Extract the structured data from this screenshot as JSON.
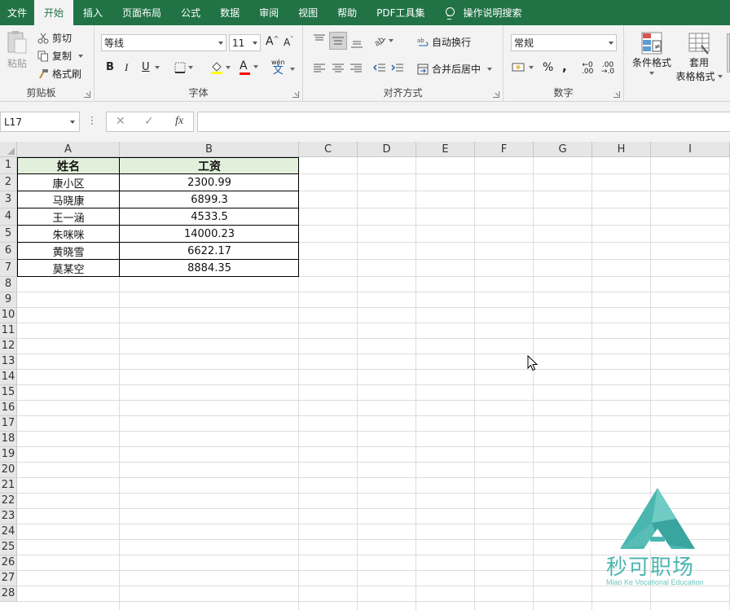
{
  "ribbon_tabs": [
    "文件",
    "开始",
    "插入",
    "页面布局",
    "公式",
    "数据",
    "审阅",
    "视图",
    "帮助",
    "PDF工具集",
    "操作说明搜索"
  ],
  "active_tab": "开始",
  "clipboard": {
    "paste": "粘贴",
    "cut": "剪切",
    "copy": "复制",
    "format_painter": "格式刷",
    "label": "剪贴板"
  },
  "font": {
    "name": "等线",
    "size": "11",
    "bold": "B",
    "italic": "I",
    "underline": "U",
    "phonetic": "wén",
    "grow": "A",
    "shrink": "A",
    "font_color": "A",
    "label": "字体"
  },
  "alignment": {
    "wrap_text": "自动换行",
    "merge_center": "合并后居中",
    "label": "对齐方式"
  },
  "number": {
    "format": "常规",
    "percent": "%",
    "comma": ",",
    "label": "数字"
  },
  "styles": {
    "conditional_formatting": "条件格式",
    "format_as_table_1": "套用",
    "format_as_table_2": "表格格式"
  },
  "formula_bar": {
    "name_box": "L17",
    "fx": "fx",
    "value": ""
  },
  "columns": [
    "A",
    "B",
    "C",
    "D",
    "E",
    "F",
    "G",
    "H",
    "I"
  ],
  "rows": [
    "1",
    "2",
    "3",
    "4",
    "5",
    "6",
    "7",
    "8",
    "9",
    "10",
    "11",
    "12",
    "13",
    "14",
    "15",
    "16",
    "17",
    "18",
    "19",
    "20",
    "21",
    "22",
    "23",
    "24",
    "25",
    "26",
    "27",
    "28"
  ],
  "table": {
    "headers": [
      "姓名",
      "工资"
    ],
    "data": [
      [
        "康小区",
        "2300.99"
      ],
      [
        "马晓康",
        "6899.3"
      ],
      [
        "王一涵",
        "4533.5"
      ],
      [
        "朱咪咪",
        "14000.23"
      ],
      [
        "黄晓雪",
        "6622.17"
      ],
      [
        "莫某空",
        "8884.35"
      ]
    ]
  },
  "watermark": {
    "name": "秒可职场",
    "sub": "Miao Ke Vocational Education"
  },
  "colors": {
    "accent": "#217346",
    "header_fill": "#e2efda",
    "watermark": "#4bb6b0"
  }
}
